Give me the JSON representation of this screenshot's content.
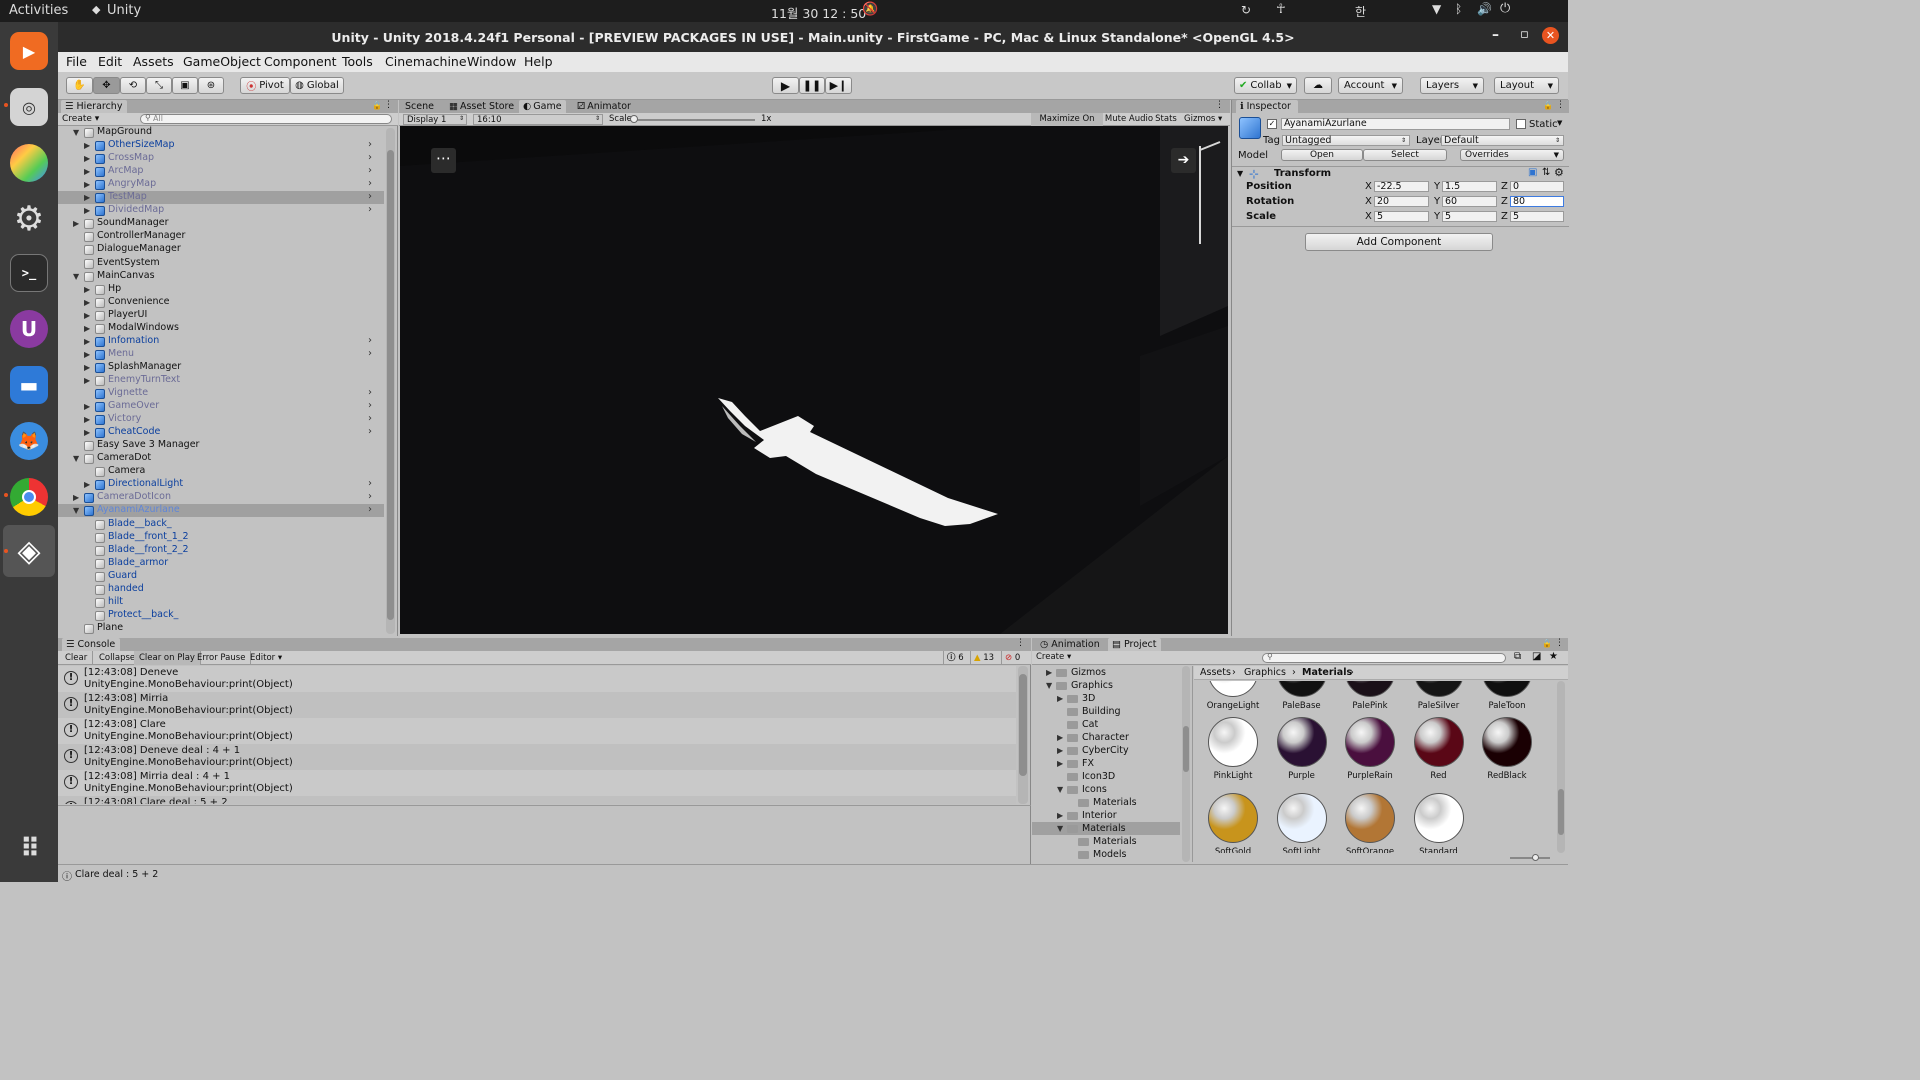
{
  "system": {
    "activities": "Activities",
    "app_name": "Unity",
    "clock": "11월 30  12 : 50",
    "input_lang": "한"
  },
  "window": {
    "title": "Unity - Unity 2018.4.24f1 Personal - [PREVIEW PACKAGES IN USE] - Main.unity - FirstGame - PC, Mac & Linux Standalone* <OpenGL 4.5>"
  },
  "menu": [
    "File",
    "Edit",
    "Assets",
    "GameObject",
    "Component",
    "Tools",
    "Cinemachine",
    "Window",
    "Help"
  ],
  "toolbar": {
    "pivot": "Pivot",
    "global": "Global",
    "collab": "Collab",
    "account": "Account",
    "layers": "Layers",
    "layout": "Layout"
  },
  "hierarchy": {
    "tab": "Hierarchy",
    "create": "Create",
    "search_placeholder": "All",
    "items": [
      {
        "label": "MapGround",
        "depth": 0,
        "arrow": "down",
        "color": "n",
        "icon": "w"
      },
      {
        "label": "OtherSizeMap",
        "depth": 1,
        "arrow": "right",
        "color": "b",
        "icon": "b",
        "chev": true
      },
      {
        "label": "CrossMap",
        "depth": 1,
        "arrow": "right",
        "color": "d",
        "icon": "b",
        "chev": true
      },
      {
        "label": "ArcMap",
        "depth": 1,
        "arrow": "right",
        "color": "d",
        "icon": "b",
        "chev": true
      },
      {
        "label": "AngryMap",
        "depth": 1,
        "arrow": "right",
        "color": "d",
        "icon": "b",
        "chev": true
      },
      {
        "label": "TestMap",
        "depth": 1,
        "arrow": "right",
        "color": "d",
        "icon": "b",
        "chev": true,
        "hl": true
      },
      {
        "label": "DividedMap",
        "depth": 1,
        "arrow": "right",
        "color": "d",
        "icon": "b",
        "chev": true
      },
      {
        "label": "SoundManager",
        "depth": 0,
        "arrow": "right",
        "color": "n",
        "icon": "w"
      },
      {
        "label": "ControllerManager",
        "depth": 0,
        "arrow": "",
        "color": "n",
        "icon": "w"
      },
      {
        "label": "DialogueManager",
        "depth": 0,
        "arrow": "",
        "color": "n",
        "icon": "w"
      },
      {
        "label": "EventSystem",
        "depth": 0,
        "arrow": "",
        "color": "n",
        "icon": "w"
      },
      {
        "label": "MainCanvas",
        "depth": 0,
        "arrow": "down",
        "color": "n",
        "icon": "w"
      },
      {
        "label": "Hp",
        "depth": 1,
        "arrow": "right",
        "color": "n",
        "icon": "w"
      },
      {
        "label": "Convenience",
        "depth": 1,
        "arrow": "right",
        "color": "n",
        "icon": "w"
      },
      {
        "label": "PlayerUI",
        "depth": 1,
        "arrow": "right",
        "color": "n",
        "icon": "w"
      },
      {
        "label": "ModalWindows",
        "depth": 1,
        "arrow": "right",
        "color": "n",
        "icon": "w"
      },
      {
        "label": "Infomation",
        "depth": 1,
        "arrow": "right",
        "color": "b",
        "icon": "b",
        "chev": true
      },
      {
        "label": "Menu",
        "depth": 1,
        "arrow": "right",
        "color": "d",
        "icon": "b",
        "chev": true
      },
      {
        "label": "SplashManager",
        "depth": 1,
        "arrow": "right",
        "color": "n",
        "icon": "b"
      },
      {
        "label": "EnemyTurnText",
        "depth": 1,
        "arrow": "right",
        "color": "d",
        "icon": "w"
      },
      {
        "label": "Vignette",
        "depth": 1,
        "arrow": "",
        "color": "d",
        "icon": "b",
        "chev": true
      },
      {
        "label": "GameOver",
        "depth": 1,
        "arrow": "right",
        "color": "d",
        "icon": "b",
        "chev": true
      },
      {
        "label": "Victory",
        "depth": 1,
        "arrow": "right",
        "color": "d",
        "icon": "b",
        "chev": true
      },
      {
        "label": "CheatCode",
        "depth": 1,
        "arrow": "right",
        "color": "b",
        "icon": "b",
        "chev": true
      },
      {
        "label": "Easy Save 3 Manager",
        "depth": 0,
        "arrow": "",
        "color": "n",
        "icon": "w"
      },
      {
        "label": "CameraDot",
        "depth": 0,
        "arrow": "down",
        "color": "n",
        "icon": "w"
      },
      {
        "label": "Camera",
        "depth": 1,
        "arrow": "",
        "color": "n",
        "icon": "w"
      },
      {
        "label": "DirectionalLight",
        "depth": 1,
        "arrow": "right",
        "color": "b",
        "icon": "b",
        "chev": true
      },
      {
        "label": "CameraDotIcon",
        "depth": 0,
        "arrow": "right",
        "color": "d",
        "icon": "b",
        "chev": true
      },
      {
        "label": "AyanamiAzurlane",
        "depth": 0,
        "arrow": "down",
        "color": "sel",
        "icon": "b",
        "chev": true,
        "sel": true
      },
      {
        "label": "Blade__back_",
        "depth": 1,
        "arrow": "",
        "color": "b",
        "icon": "w"
      },
      {
        "label": "Blade__front_1_2",
        "depth": 1,
        "arrow": "",
        "color": "b",
        "icon": "w"
      },
      {
        "label": "Blade__front_2_2",
        "depth": 1,
        "arrow": "",
        "color": "b",
        "icon": "w"
      },
      {
        "label": "Blade_armor",
        "depth": 1,
        "arrow": "",
        "color": "b",
        "icon": "w"
      },
      {
        "label": "Guard",
        "depth": 1,
        "arrow": "",
        "color": "b",
        "icon": "w"
      },
      {
        "label": "handed",
        "depth": 1,
        "arrow": "",
        "color": "b",
        "icon": "w"
      },
      {
        "label": "hilt",
        "depth": 1,
        "arrow": "",
        "color": "b",
        "icon": "w"
      },
      {
        "label": "Protect__back_",
        "depth": 1,
        "arrow": "",
        "color": "b",
        "icon": "w"
      },
      {
        "label": "Plane",
        "depth": 0,
        "arrow": "",
        "color": "n",
        "icon": "w"
      }
    ]
  },
  "view_tabs": {
    "scene": "Scene",
    "asset_store": "Asset Store",
    "game": "Game",
    "animator": "Animator"
  },
  "game_bar": {
    "display": "Display 1",
    "aspect": "16:10",
    "scale_label": "Scale",
    "scale_value": "1x",
    "maximize": "Maximize On Play",
    "mute": "Mute Audio",
    "stats": "Stats",
    "gizmos": "Gizmos"
  },
  "inspector": {
    "tab": "Inspector",
    "object_name": "AyanamiAzurlane",
    "static_label": "Static",
    "tag_label": "Tag",
    "tag_value": "Untagged",
    "layer_label": "Layer",
    "layer_value": "Default",
    "model_label": "Model",
    "open": "Open",
    "select": "Select",
    "overrides": "Overrides",
    "transform_title": "Transform",
    "position_label": "Position",
    "rotation_label": "Rotation",
    "scale_label": "Scale",
    "axis_x": "X",
    "axis_y": "Y",
    "axis_z": "Z",
    "position": {
      "x": "-22.5",
      "y": "1.5",
      "z": "0"
    },
    "rotation": {
      "x": "20",
      "y": "60",
      "z": "80"
    },
    "scale": {
      "x": "5",
      "y": "5",
      "z": "5"
    },
    "add_component": "Add Component"
  },
  "console": {
    "tab": "Console",
    "clear": "Clear",
    "collapse": "Collapse",
    "clear_on_play": "Clear on Play",
    "error_pause": "Error Pause",
    "editor": "Editor",
    "count_info": "6",
    "count_warn": "13",
    "count_error": "0",
    "lines": [
      {
        "msg": "[12:43:08] Deneve",
        "trace": "UnityEngine.MonoBehaviour:print(Object)"
      },
      {
        "msg": "[12:43:08] Mirria",
        "trace": "UnityEngine.MonoBehaviour:print(Object)"
      },
      {
        "msg": "[12:43:08] Clare",
        "trace": "UnityEngine.MonoBehaviour:print(Object)"
      },
      {
        "msg": "[12:43:08] Deneve deal : 4 + 1",
        "trace": "UnityEngine.MonoBehaviour:print(Object)"
      },
      {
        "msg": "[12:43:08] Mirria deal : 4 + 1",
        "trace": "UnityEngine.MonoBehaviour:print(Object)"
      },
      {
        "msg": "[12:43:08] Clare deal : 5 + 2",
        "trace": ""
      }
    ],
    "status": "Clare deal : 5 + 2"
  },
  "project": {
    "tab_animation": "Animation",
    "tab_project": "Project",
    "create": "Create",
    "breadcrumb": [
      "Assets",
      "Graphics",
      "Materials"
    ],
    "folders": [
      {
        "label": "Gizmos",
        "depth": 0,
        "arrow": "right"
      },
      {
        "label": "Graphics",
        "depth": 0,
        "arrow": "down"
      },
      {
        "label": "3D",
        "depth": 1,
        "arrow": "right"
      },
      {
        "label": "Building",
        "depth": 1,
        "arrow": ""
      },
      {
        "label": "Cat",
        "depth": 1,
        "arrow": ""
      },
      {
        "label": "Character",
        "depth": 1,
        "arrow": "right"
      },
      {
        "label": "CyberCity",
        "depth": 1,
        "arrow": "right"
      },
      {
        "label": "FX",
        "depth": 1,
        "arrow": "right"
      },
      {
        "label": "Icon3D",
        "depth": 1,
        "arrow": ""
      },
      {
        "label": "Icons",
        "depth": 1,
        "arrow": "down"
      },
      {
        "label": "Materials",
        "depth": 2,
        "arrow": ""
      },
      {
        "label": "Interior",
        "depth": 1,
        "arrow": "right"
      },
      {
        "label": "Materials",
        "depth": 1,
        "arrow": "down",
        "sel": true
      },
      {
        "label": "Materials",
        "depth": 2,
        "arrow": ""
      },
      {
        "label": "Models",
        "depth": 2,
        "arrow": ""
      }
    ],
    "materials_row1": [
      {
        "label": "OrangeLight",
        "color": "#ffffff"
      },
      {
        "label": "PaleBase",
        "color": "#111111"
      },
      {
        "label": "PalePink",
        "color": "#1a1018"
      },
      {
        "label": "PaleSilver",
        "color": "#151515"
      },
      {
        "label": "PaleToon",
        "color": "#101010"
      }
    ],
    "materials_row2": [
      {
        "label": "PinkLight",
        "color": "#ffffff"
      },
      {
        "label": "Purple",
        "color": "#2a1133"
      },
      {
        "label": "PurpleRain",
        "color": "#4a0f3e"
      },
      {
        "label": "Red",
        "color": "#5a0716"
      },
      {
        "label": "RedBlack",
        "color": "#1a0003"
      }
    ],
    "materials_row3": [
      {
        "label": "SoftGold",
        "color": "#c8941c"
      },
      {
        "label": "SoftLight",
        "color": "#eaf3ff"
      },
      {
        "label": "SoftOrange",
        "color": "#b27635"
      },
      {
        "label": "Standard",
        "color": "#ffffff"
      }
    ]
  },
  "colors": {
    "unity_accent": "#3e7be0",
    "selected_object": "#5f86d8"
  }
}
